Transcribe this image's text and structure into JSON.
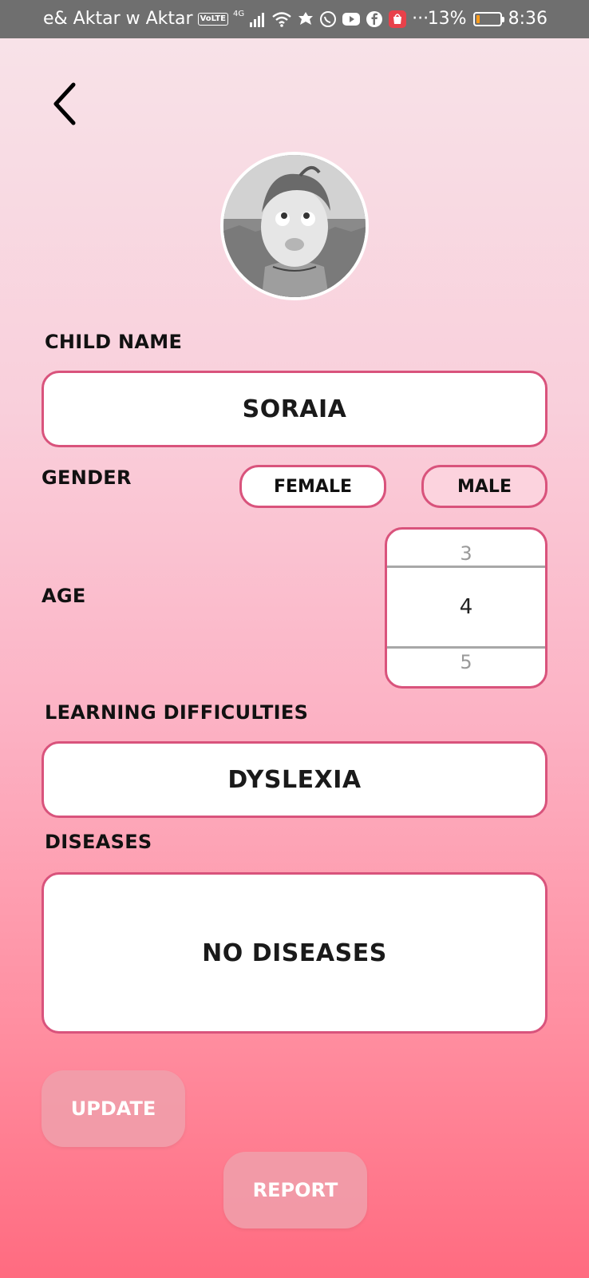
{
  "status_bar": {
    "carrier": "e& Aktar w Aktar",
    "volte": "VoLTE",
    "network": "4G",
    "more": "···",
    "battery_percent": "13%",
    "time": "8:36",
    "icons": [
      "volte-icon",
      "signal-icon",
      "wifi-icon",
      "notification-icon",
      "whatsapp-icon",
      "youtube-icon",
      "facebook-icon",
      "shopping-app-icon",
      "battery-icon"
    ]
  },
  "colors": {
    "accent_border": "#d9537c",
    "gradient_top": "#f8e2e8",
    "gradient_bottom": "#ff6b80",
    "button_bg": "#f0a0ac"
  },
  "profile": {
    "child_name_label": "CHILD NAME",
    "child_name_value": "SORAIA",
    "gender_label": "GENDER",
    "gender_options": [
      "FEMALE",
      "MALE"
    ],
    "gender_selected": "FEMALE",
    "age_label": "AGE",
    "age_picker": {
      "previous": "3",
      "selected": "4",
      "next": "5"
    },
    "learning_label": "LEARNING DIFFICULTIES",
    "learning_value": "DYSLEXIA",
    "diseases_label": "DISEASES",
    "diseases_value": "NO DISEASES"
  },
  "actions": {
    "update_label": "UPDATE",
    "report_label": "REPORT"
  }
}
